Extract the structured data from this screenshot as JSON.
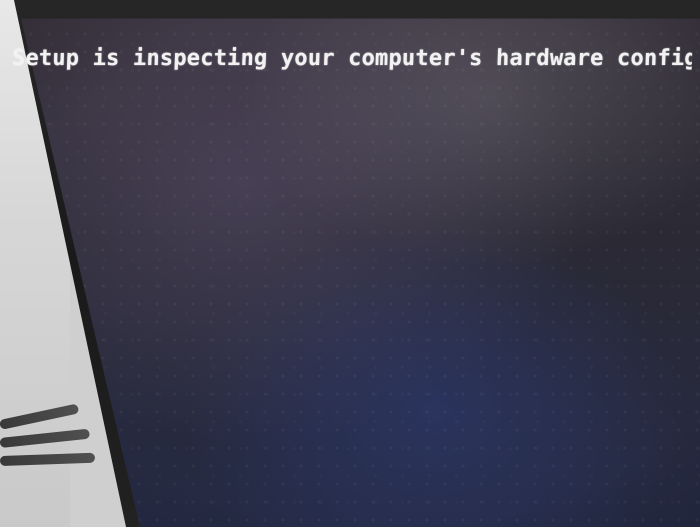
{
  "screen": {
    "message": "Setup is inspecting your computer's hardware configuration..."
  },
  "colors": {
    "text": "#f2f2f2",
    "screen_dark": "#252a44",
    "bezel": "#1f1f1f",
    "background": "#d9d9d9"
  }
}
